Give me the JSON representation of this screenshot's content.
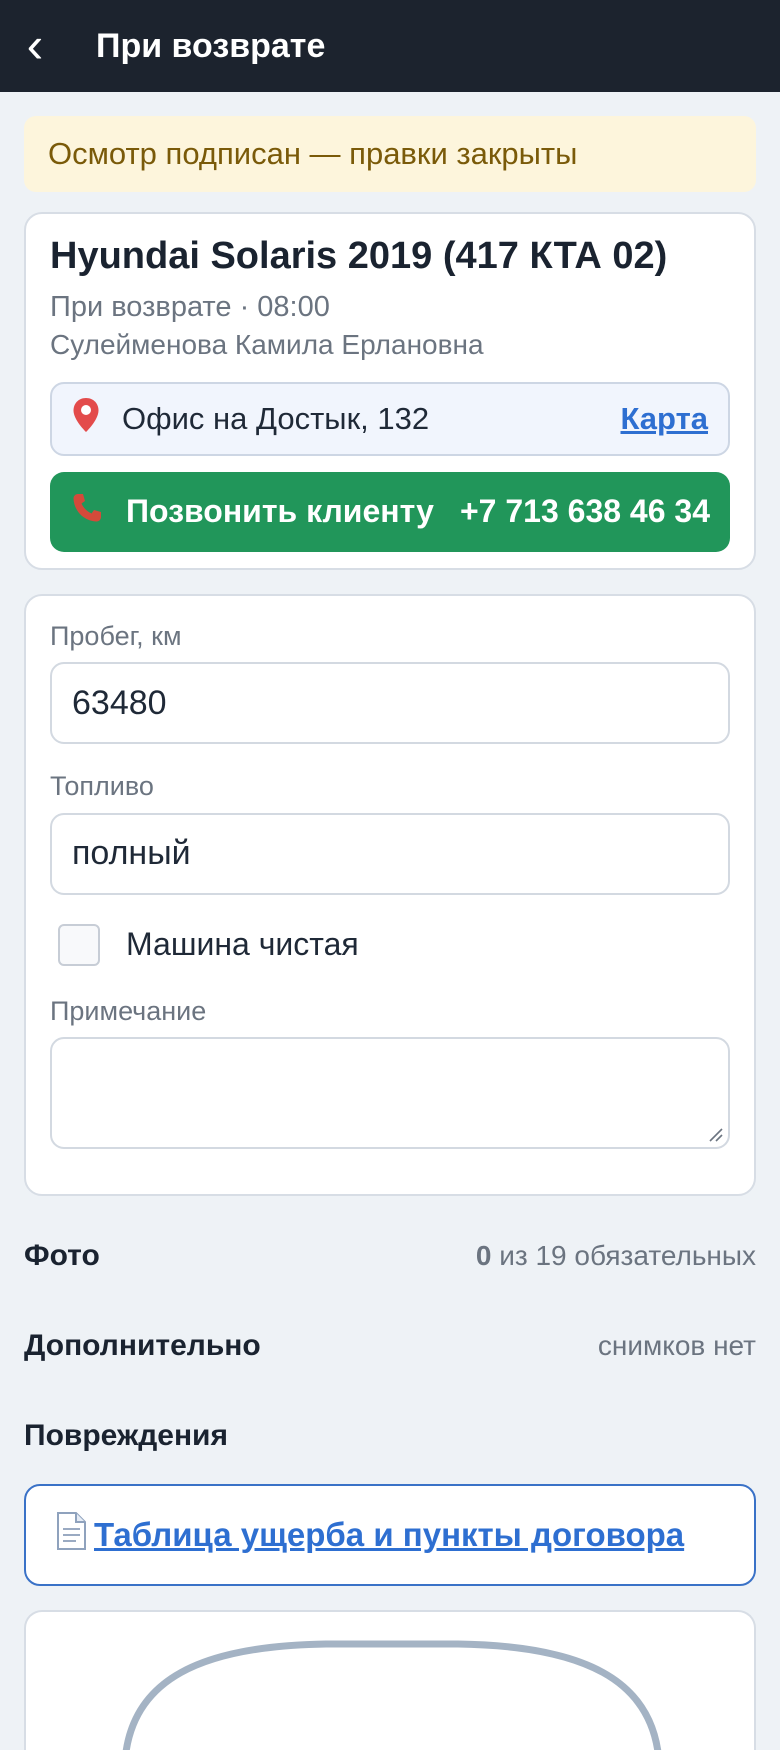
{
  "header": {
    "back_glyph": "‹",
    "title": "При возврате"
  },
  "banner": {
    "text": "Осмотр подписан — правки закрыты"
  },
  "booking": {
    "car_title": "Hyundai Solaris 2019 (417 КТА 02)",
    "stage_time": "При возврате · 08:00",
    "client_name": "Сулейменова Камила Ерлановна",
    "location": {
      "icon": "map-pin-icon",
      "address": "Офис на Достык, 132",
      "map_link": "Карта"
    },
    "call": {
      "icon": "phone-icon",
      "label": "Позвонить клиенту",
      "number": "+7 713 638 46 34",
      "color": "#21965a"
    }
  },
  "form": {
    "mileage": {
      "label": "Пробег, км",
      "value": "63480"
    },
    "fuel": {
      "label": "Топливо",
      "value": "полный"
    },
    "clean": {
      "label": "Машина чистая",
      "checked": false
    },
    "note": {
      "label": "Примечание",
      "value": ""
    }
  },
  "sections": {
    "photos": {
      "title": "Фото",
      "done": "0",
      "rest": " из 19 обязательных"
    },
    "extra": {
      "title": "Дополнительно",
      "meta": "снимков нет"
    },
    "damage": {
      "title": "Повреждения",
      "table_link": "Таблица ущерба и пункты договора",
      "icon": "document-icon"
    }
  },
  "colors": {
    "header_bg": "#1c232e",
    "banner_bg": "#fdf5dc",
    "banner_text": "#7a5a09",
    "link": "#2e6fd1",
    "accent_green": "#21965a"
  }
}
